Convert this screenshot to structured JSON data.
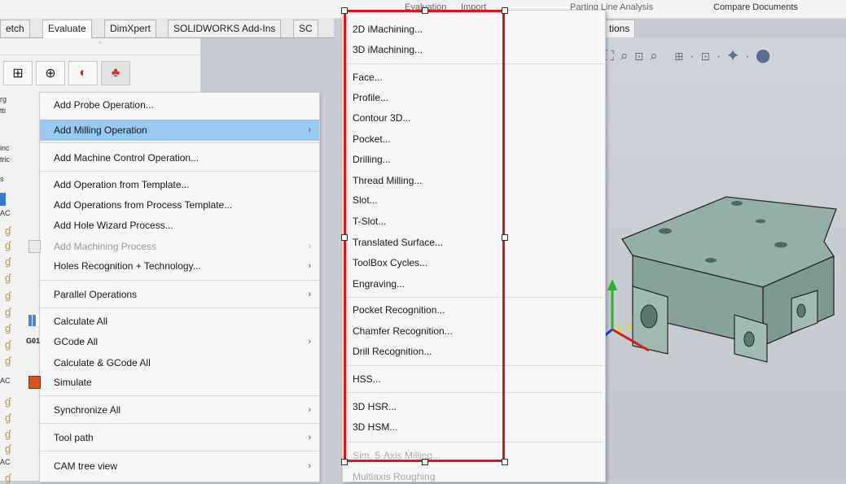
{
  "topbar": {
    "evaluation": "Evaluation",
    "import": "Import",
    "parting": "Parting Line Analysis",
    "compare": "Compare Documents"
  },
  "tabs": [
    "etch",
    "Evaluate",
    "DimXpert",
    "SOLIDWORKS Add-Ins",
    "SC"
  ],
  "right_tab": "tions",
  "left_tree": {
    "fragments": [
      "rg",
      "tti",
      "inc",
      "tric",
      "s",
      "AC",
      "AC",
      "AC",
      "AC"
    ]
  },
  "context_menu": {
    "items": [
      {
        "label": "Add Probe Operation...",
        "submenu": false
      },
      {
        "label": "Add Milling Operation",
        "submenu": true,
        "highlighted": true
      },
      {
        "label": "Add Machine Control Operation...",
        "submenu": false
      },
      {
        "label": "Add Operation from Template...",
        "submenu": false
      },
      {
        "label": "Add Operations from Process Template...",
        "submenu": false
      },
      {
        "label": "Add Hole Wizard Process...",
        "submenu": false
      },
      {
        "label": "Add Machining Process",
        "submenu": true,
        "disabled": true
      },
      {
        "label": "Holes Recognition + Technology...",
        "submenu": true
      },
      {
        "label": "Parallel Operations",
        "submenu": true
      },
      {
        "label": "Calculate All",
        "submenu": false
      },
      {
        "label": "GCode All",
        "submenu": true
      },
      {
        "label": "Calculate & GCode All",
        "submenu": false
      },
      {
        "label": "Simulate",
        "submenu": false
      },
      {
        "label": "Synchronize All",
        "submenu": true
      },
      {
        "label": "Tool path",
        "submenu": true
      },
      {
        "label": "CAM tree view",
        "submenu": true
      }
    ],
    "gcode_icon_text": "G01",
    "arrow": "›"
  },
  "submenu": {
    "items": [
      "2D iMachining...",
      "3D iMachining...",
      "Face...",
      "Profile...",
      "Contour 3D...",
      "Pocket...",
      "Drilling...",
      "Thread Milling...",
      "Slot...",
      "T-Slot...",
      "Translated Surface...",
      "ToolBox Cycles...",
      "Engraving...",
      "Pocket Recognition...",
      "Chamfer Recognition...",
      "Drill Recognition...",
      "HSS...",
      "3D HSR...",
      "3D HSM...",
      "Sim. 5-Axis Milling...",
      "Multiaxis Roughing"
    ]
  },
  "colors": {
    "highlight": "#99c9f2",
    "redbox": "#e0141e",
    "part": "#8faba3"
  }
}
